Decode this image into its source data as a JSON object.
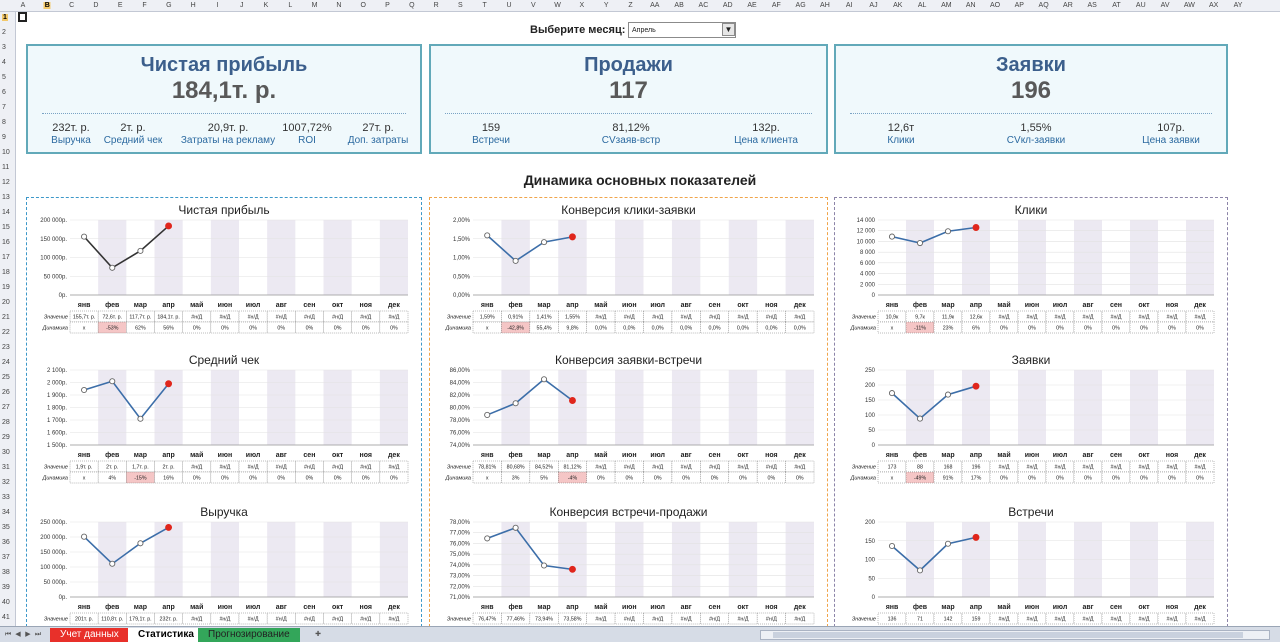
{
  "columns": [
    "A",
    "B",
    "C",
    "D",
    "E",
    "F",
    "G",
    "H",
    "I",
    "J",
    "K",
    "L",
    "M",
    "N",
    "O",
    "P",
    "Q",
    "R",
    "S",
    "T",
    "U",
    "V",
    "W",
    "X",
    "Y",
    "Z",
    "AA",
    "AB",
    "AC",
    "AD",
    "AE",
    "AF",
    "AG",
    "AH",
    "AI",
    "AJ",
    "AK",
    "AL",
    "AM",
    "AN",
    "AO",
    "AP",
    "AQ",
    "AR",
    "AS",
    "AT",
    "AU",
    "AV",
    "AW",
    "AX",
    "AY"
  ],
  "active_column": "B",
  "rows": [
    "1",
    "2",
    "3",
    "4",
    "5",
    "6",
    "7",
    "8",
    "9",
    "10",
    "11",
    "12",
    "13",
    "14",
    "15",
    "16",
    "17",
    "18",
    "19",
    "20",
    "21",
    "22",
    "23",
    "24",
    "25",
    "26",
    "27",
    "28",
    "29",
    "30",
    "31",
    "32",
    "33",
    "34",
    "35",
    "36",
    "37",
    "38",
    "39",
    "40",
    "41"
  ],
  "active_row": "1",
  "month_selector": {
    "label": "Выберите месяц:",
    "value": "Апрель"
  },
  "kpis": [
    {
      "title": "Чистая прибыль",
      "value": "184,1т. р.",
      "subs": [
        {
          "v": "232т. р.",
          "l": "Выручка"
        },
        {
          "v": "2т. р.",
          "l": "Средний чек"
        },
        {
          "v": "20,9т. р.",
          "l": "Затраты на рекламу"
        },
        {
          "v": "1007,72%",
          "l": "ROI"
        },
        {
          "v": "27т. р.",
          "l": "Доп. затраты"
        }
      ]
    },
    {
      "title": "Продажи",
      "value": "117",
      "subs": [
        {
          "v": "159",
          "l": "Встречи"
        },
        {
          "v": "81,12%",
          "l": "CVзаяв-встр"
        },
        {
          "v": "132р.",
          "l": "Цена клиента"
        }
      ]
    },
    {
      "title": "Заявки",
      "value": "196",
      "subs": [
        {
          "v": "12,6т",
          "l": "Клики"
        },
        {
          "v": "1,55%",
          "l": "CVкл-заявки"
        },
        {
          "v": "107р.",
          "l": "Цена заявки"
        }
      ]
    }
  ],
  "dynamics_title": "Динамика основных показателей",
  "months": [
    "янв",
    "фев",
    "мар",
    "апр",
    "май",
    "июн",
    "июл",
    "авг",
    "сен",
    "окт",
    "ноя",
    "дек"
  ],
  "table_labels": {
    "value": "Значение",
    "dynamics": "Динамика"
  },
  "colors": {
    "kpi_border": "#62a9b9",
    "kpi_title": "#3c5f8c",
    "group1_border": "#3d98c9",
    "group2_border": "#f0a44a",
    "group3_border": "#8c84a8",
    "line_dark": "#333333",
    "line_blue": "#3c6ea9",
    "current_point": "#e0261c",
    "column_shade": "#ece9f2",
    "negative_cell": "#f5c6c6"
  },
  "chart_data": [
    {
      "type": "line",
      "title": "Чистая прибыль",
      "categories": [
        "янв",
        "фев",
        "мар",
        "апр"
      ],
      "values": [
        155700,
        72600,
        117700,
        184100
      ],
      "y_ticks": [
        "200 000р.",
        "150 000р.",
        "100 000р.",
        "50 000р.",
        "0р."
      ],
      "ylim": [
        0,
        200000
      ],
      "line": "dark",
      "table": {
        "values": [
          "155,7т. р.",
          "72,6т. р.",
          "117,7т. р.",
          "184,1т. р.",
          "#н/Д",
          "#н/Д",
          "#н/Д",
          "#н/Д",
          "#н/Д",
          "#н/Д",
          "#н/Д",
          "#н/Д"
        ],
        "dynamics": [
          "x",
          "-53%",
          "62%",
          "56%",
          "0%",
          "0%",
          "0%",
          "0%",
          "0%",
          "0%",
          "0%",
          "0%"
        ]
      }
    },
    {
      "type": "line",
      "title": "Средний чек",
      "categories": [
        "янв",
        "фев",
        "мар",
        "апр"
      ],
      "values": [
        1940,
        2010,
        1710,
        1990
      ],
      "y_ticks": [
        "2 100р.",
        "2 000р.",
        "1 900р.",
        "1 800р.",
        "1 700р.",
        "1 600р.",
        "1 500р."
      ],
      "ylim": [
        1500,
        2100
      ],
      "line": "blue",
      "table": {
        "values": [
          "1,9т. р.",
          "2т. р.",
          "1,7т. р.",
          "2т. р.",
          "#н/Д",
          "#н/Д",
          "#н/Д",
          "#н/Д",
          "#н/Д",
          "#н/Д",
          "#н/Д",
          "#н/Д"
        ],
        "dynamics": [
          "x",
          "4%",
          "-15%",
          "16%",
          "0%",
          "0%",
          "0%",
          "0%",
          "0%",
          "0%",
          "0%",
          "0%"
        ]
      }
    },
    {
      "type": "line",
      "title": "Выручка",
      "categories": [
        "янв",
        "фев",
        "мар",
        "апр"
      ],
      "values": [
        201000,
        110800,
        179100,
        232000
      ],
      "y_ticks": [
        "250 000р.",
        "200 000р.",
        "150 000р.",
        "100 000р.",
        "50 000р.",
        "0р."
      ],
      "ylim": [
        0,
        250000
      ],
      "line": "blue",
      "table": {
        "values": [
          "201т. р.",
          "110,8т. р.",
          "179,1т. р.",
          "232т. р.",
          "#н/Д",
          "#н/Д",
          "#н/Д",
          "#н/Д",
          "#н/Д",
          "#н/Д",
          "#н/Д",
          "#н/Д"
        ],
        "dynamics": null
      }
    },
    {
      "type": "line",
      "title": "Конверсия клики-заявки",
      "categories": [
        "янв",
        "фев",
        "мар",
        "апр"
      ],
      "values": [
        1.59,
        0.91,
        1.41,
        1.55
      ],
      "y_ticks": [
        "2,00%",
        "1,50%",
        "1,00%",
        "0,50%",
        "0,00%"
      ],
      "ylim": [
        0,
        2
      ],
      "line": "blue",
      "table": {
        "values": [
          "1,59%",
          "0,91%",
          "1,41%",
          "1,55%",
          "#н/Д",
          "#н/Д",
          "#н/Д",
          "#н/Д",
          "#н/Д",
          "#н/Д",
          "#н/Д",
          "#н/Д"
        ],
        "dynamics": [
          "x",
          "-42,8%",
          "55,4%",
          "9,8%",
          "0,0%",
          "0,0%",
          "0,0%",
          "0,0%",
          "0,0%",
          "0,0%",
          "0,0%",
          "0,0%"
        ]
      }
    },
    {
      "type": "line",
      "title": "Конверсия заявки-встречи",
      "categories": [
        "янв",
        "фев",
        "мар",
        "апр"
      ],
      "values": [
        78.81,
        80.68,
        84.52,
        81.12
      ],
      "y_ticks": [
        "86,00%",
        "84,00%",
        "82,00%",
        "80,00%",
        "78,00%",
        "76,00%",
        "74,00%"
      ],
      "ylim": [
        74,
        86
      ],
      "line": "blue",
      "table": {
        "values": [
          "78,81%",
          "80,68%",
          "84,52%",
          "81,12%",
          "#н/Д",
          "#н/Д",
          "#н/Д",
          "#н/Д",
          "#н/Д",
          "#н/Д",
          "#н/Д",
          "#н/Д"
        ],
        "dynamics": [
          "x",
          "3%",
          "5%",
          "-4%",
          "0%",
          "0%",
          "0%",
          "0%",
          "0%",
          "0%",
          "0%",
          "0%"
        ]
      }
    },
    {
      "type": "line",
      "title": "Конверсия встречи-продажи",
      "categories": [
        "янв",
        "фев",
        "мар",
        "апр"
      ],
      "values": [
        76.47,
        77.46,
        73.94,
        73.58
      ],
      "y_ticks": [
        "78,00%",
        "77,00%",
        "76,00%",
        "75,00%",
        "74,00%",
        "73,00%",
        "72,00%",
        "71,00%"
      ],
      "ylim": [
        71,
        78
      ],
      "line": "blue",
      "table": {
        "values": [
          "76,47%",
          "77,46%",
          "73,94%",
          "73,58%",
          "#н/Д",
          "#н/Д",
          "#н/Д",
          "#н/Д",
          "#н/Д",
          "#н/Д",
          "#н/Д",
          "#н/Д"
        ],
        "dynamics": null
      }
    },
    {
      "type": "line",
      "title": "Клики",
      "categories": [
        "янв",
        "фев",
        "мар",
        "апр"
      ],
      "values": [
        10900,
        9700,
        11900,
        12600
      ],
      "y_ticks": [
        "14 000",
        "12 000",
        "10 000",
        "8 000",
        "6 000",
        "4 000",
        "2 000",
        "0"
      ],
      "ylim": [
        0,
        14000
      ],
      "line": "blue",
      "table": {
        "values": [
          "10,9к",
          "9,7к",
          "11,9к",
          "12,6к",
          "#н/Д",
          "#н/Д",
          "#н/Д",
          "#н/Д",
          "#н/Д",
          "#н/Д",
          "#н/Д",
          "#н/Д"
        ],
        "dynamics": [
          "x",
          "-11%",
          "23%",
          "6%",
          "0%",
          "0%",
          "0%",
          "0%",
          "0%",
          "0%",
          "0%",
          "0%"
        ]
      }
    },
    {
      "type": "line",
      "title": "Заявки",
      "categories": [
        "янв",
        "фев",
        "мар",
        "апр"
      ],
      "values": [
        173,
        88,
        168,
        196
      ],
      "y_ticks": [
        "250",
        "200",
        "150",
        "100",
        "50",
        "0"
      ],
      "ylim": [
        0,
        250
      ],
      "line": "blue",
      "table": {
        "values": [
          "173",
          "88",
          "168",
          "196",
          "#н/Д",
          "#н/Д",
          "#н/Д",
          "#н/Д",
          "#н/Д",
          "#н/Д",
          "#н/Д",
          "#н/Д"
        ],
        "dynamics": [
          "x",
          "-49%",
          "91%",
          "17%",
          "0%",
          "0%",
          "0%",
          "0%",
          "0%",
          "0%",
          "0%",
          "0%"
        ]
      }
    },
    {
      "type": "line",
      "title": "Встречи",
      "categories": [
        "янв",
        "фев",
        "мар",
        "апр"
      ],
      "values": [
        136,
        71,
        142,
        159
      ],
      "y_ticks": [
        "200",
        "150",
        "100",
        "50",
        "0"
      ],
      "ylim": [
        0,
        200
      ],
      "line": "blue",
      "table": {
        "values": [
          "136",
          "71",
          "142",
          "159",
          "#н/Д",
          "#н/Д",
          "#н/Д",
          "#н/Д",
          "#н/Д",
          "#н/Д",
          "#н/Д",
          "#н/Д"
        ],
        "dynamics": null
      }
    }
  ],
  "sheet_tabs": [
    "Учет данных",
    "Статистика",
    "Прогнозирование"
  ],
  "active_tab": "Статистика"
}
